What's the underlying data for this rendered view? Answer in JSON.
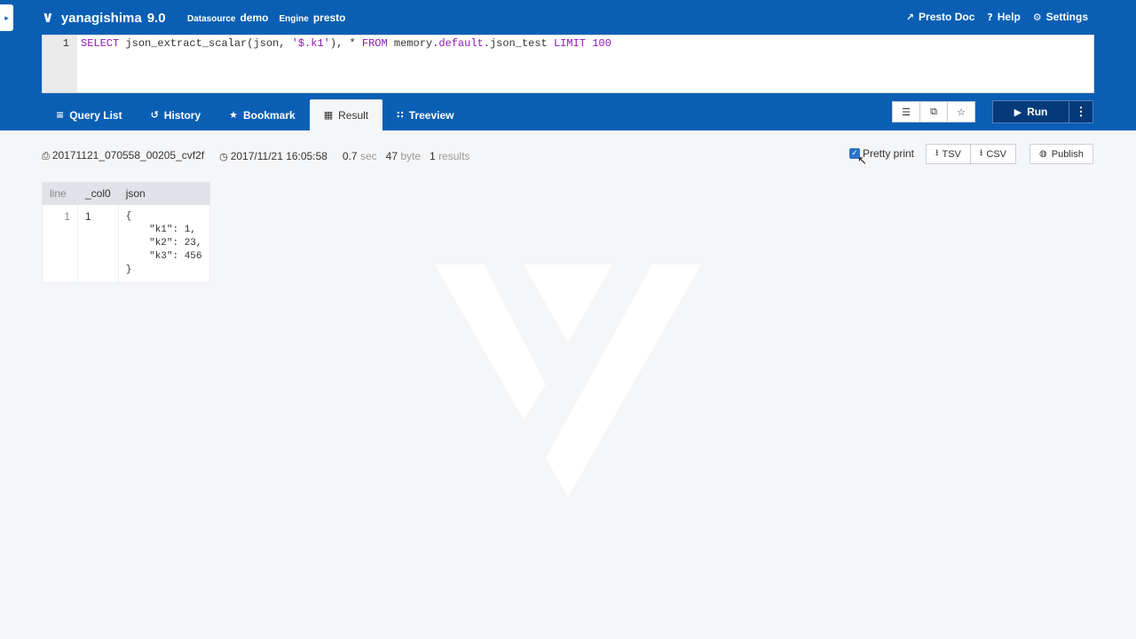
{
  "app": {
    "logo_glyph": "∨",
    "name": "yanagishima",
    "version": "9.0",
    "sidebar_toggle_glyph": "▸"
  },
  "meta": {
    "datasource_label": "Datasource",
    "datasource_value": "demo",
    "engine_label": "Engine",
    "engine_value": "presto"
  },
  "top_links": [
    {
      "icon": "external-link-icon",
      "glyph": "↗",
      "label": "Presto Doc"
    },
    {
      "icon": "question-icon",
      "glyph": "?",
      "label": "Help"
    },
    {
      "icon": "gear-icon",
      "glyph": "⚙",
      "label": "Settings"
    }
  ],
  "editor": {
    "line_number": "1",
    "tokens": {
      "select": "SELECT",
      "func": " json_extract_scalar(json, ",
      "str": "'$.k1'",
      "sep": "), ",
      "star": "*",
      "from": " FROM ",
      "t1": "memory.",
      "t2": "default",
      "t3": ".json_test ",
      "limit": "LIMIT ",
      "num": "100"
    }
  },
  "tabs": [
    {
      "icon": "list-icon",
      "glyph": "≡",
      "label": "Query List",
      "active": false
    },
    {
      "icon": "history-icon",
      "glyph": "↺",
      "label": "History",
      "active": false
    },
    {
      "icon": "star-icon",
      "glyph": "★",
      "label": "Bookmark",
      "active": false
    },
    {
      "icon": "table-icon",
      "glyph": "▦",
      "label": "Result",
      "active": true
    },
    {
      "icon": "sitemap-icon",
      "glyph": "∷",
      "label": "Treeview",
      "active": false
    }
  ],
  "toolbar": {
    "format_glyph": "☰",
    "copy_glyph": "⧉",
    "bookmark_glyph": "☆",
    "run_glyph": "▶",
    "run_label": "Run",
    "more_glyph": "⋮"
  },
  "result_info": {
    "file_glyph": "⎙",
    "query_id": "20171121_070558_00205_cvf2f",
    "clock_glyph": "◷",
    "datetime": "2017/11/21 16:05:58",
    "elapsed_value": "0.7",
    "elapsed_unit": "sec",
    "size_value": "47",
    "size_unit": "byte",
    "count_value": "1",
    "count_unit": "results"
  },
  "result_actions": {
    "pretty_print_label": "Pretty print",
    "pretty_print_checked": true,
    "check_glyph": "✓",
    "cursor_glyph": "↖",
    "download_glyph": "⭳",
    "tsv_label": "TSV",
    "csv_label": "CSV",
    "globe_glyph": "◍",
    "publish_label": "Publish"
  },
  "table": {
    "headers": [
      "line",
      "_col0",
      "json"
    ],
    "rows": [
      {
        "line": "1",
        "col0": "1",
        "json": "{\n    \"k1\": 1,\n    \"k2\": 23,\n    \"k3\": 456\n}"
      }
    ]
  },
  "colors": {
    "header_bg": "#0a5fb4",
    "run_bg": "#053a7a",
    "page_bg": "#f5f6f8"
  }
}
